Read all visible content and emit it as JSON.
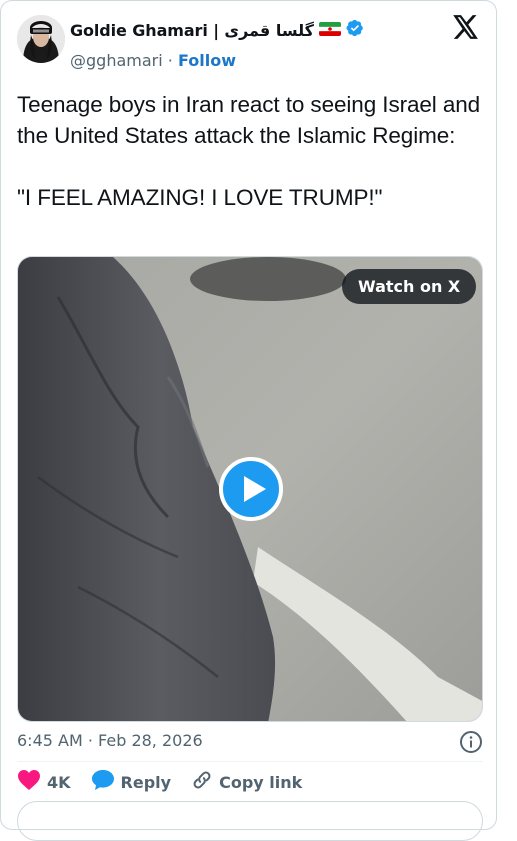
{
  "author": {
    "display_name": "Goldie Ghamari | گلسا قمری",
    "handle": "@gghamari",
    "separator": "·",
    "follow_label": "Follow",
    "verified_color": "#1d9bf0"
  },
  "tweet": {
    "text": "Teenage boys in Iran react to seeing Israel and the United States attack the Islamic Regime:\n\n\"I FEEL AMAZING! I LOVE TRUMP!\"",
    "timestamp": "6:45 AM · Feb 28, 2026"
  },
  "media": {
    "watch_label": "Watch on X",
    "play_icon": "play-icon"
  },
  "actions": {
    "likes_count": "4K",
    "reply_label": "Reply",
    "copy_link_label": "Copy link"
  },
  "colors": {
    "like": "#f91880",
    "reply": "#1d9bf0",
    "link_text": "#1d77c9",
    "muted": "#536471"
  }
}
